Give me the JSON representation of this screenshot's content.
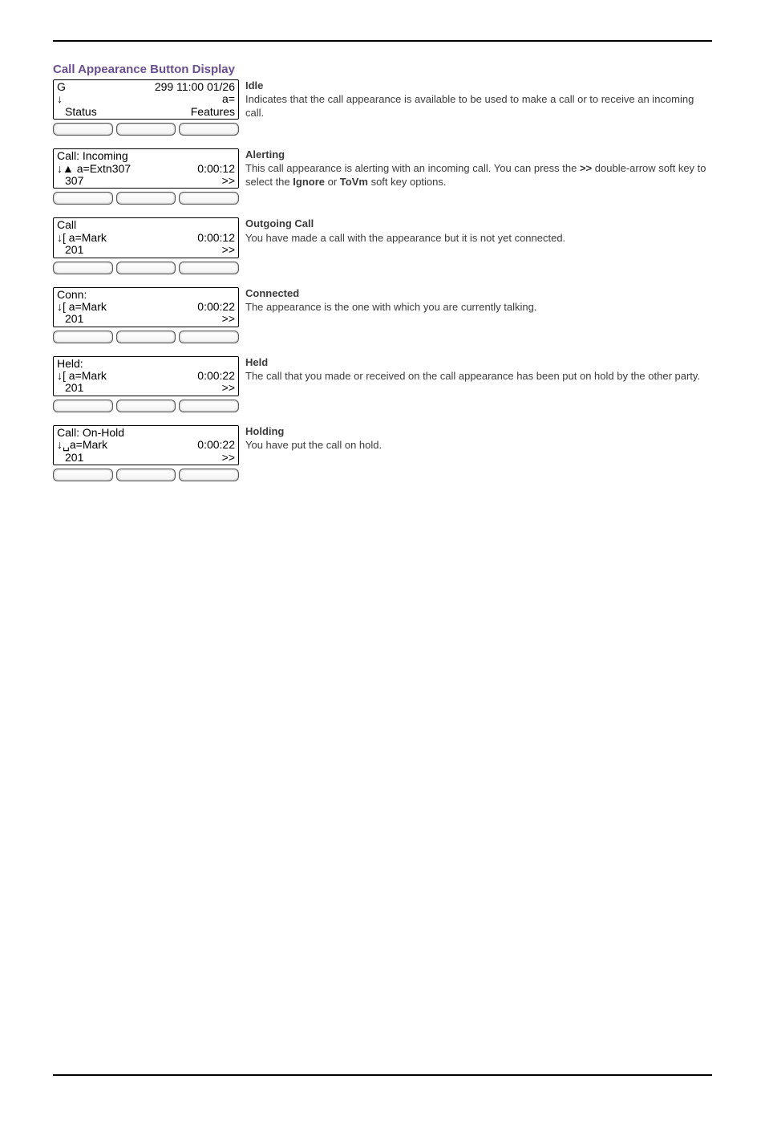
{
  "section_title": "Call Appearance Button Display",
  "states": [
    {
      "screen": {
        "l1_left": "G",
        "l1_right": "299 11:00 01/26",
        "l2_left": "↓",
        "l2_right": "a=",
        "l3_left": "Status",
        "l3_right": "Features"
      },
      "title": "Idle",
      "text_parts": [
        "Indicates that the call appearance is available to be used to make a call or to receive an incoming call."
      ]
    },
    {
      "screen": {
        "l1_left": "Call: Incoming",
        "l1_right": "",
        "l2_left": "↓▲ a=Extn307",
        "l2_right": "0:00:12",
        "l3_left": "307",
        "l3_right": ">>"
      },
      "title": "Alerting",
      "text_parts": [
        "This call appearance is alerting with an incoming call. You can press the ",
        ">>",
        " double-arrow soft key to select the ",
        "Ignore",
        " or ",
        "ToVm",
        " soft key options."
      ]
    },
    {
      "screen": {
        "l1_left": "Call",
        "l1_right": "",
        "l2_left": "↓[ a=Mark",
        "l2_right": "0:00:12",
        "l3_left": "201",
        "l3_right": ">>"
      },
      "title": "Outgoing Call",
      "text_parts": [
        "You have made a call with the appearance but it is not yet connected."
      ]
    },
    {
      "screen": {
        "l1_left": "Conn:",
        "l1_right": "",
        "l2_left": "↓[ a=Mark",
        "l2_right": "0:00:22",
        "l3_left": "201",
        "l3_right": ">>"
      },
      "title": "Connected",
      "text_parts": [
        "The appearance is the one with which you are currently talking."
      ]
    },
    {
      "screen": {
        "l1_left": "Held:",
        "l1_right": "",
        "l2_left": "↓[ a=Mark",
        "l2_right": "0:00:22",
        "l3_left": "201",
        "l3_right": ">>"
      },
      "title": "Held",
      "text_parts": [
        "The call that you made or received on the call appearance has been put on hold by the other party."
      ]
    },
    {
      "screen": {
        "l1_left": "Call: On-Hold",
        "l1_right": "",
        "l2_left": "↓␣a=Mark",
        "l2_right": "0:00:22",
        "l3_left": "201",
        "l3_right": ">>"
      },
      "title": "Holding",
      "text_parts": [
        "You have put the call on hold."
      ]
    }
  ]
}
